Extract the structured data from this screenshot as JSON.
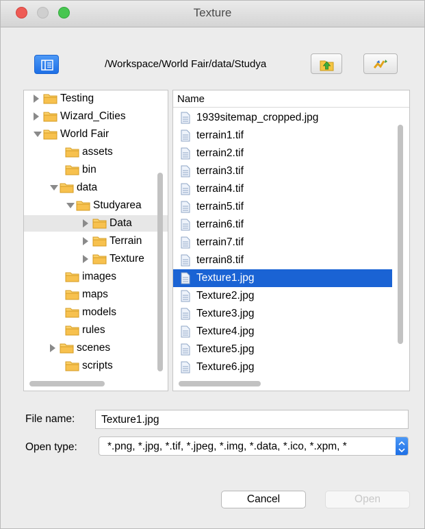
{
  "window": {
    "title": "Texture"
  },
  "toolbar": {
    "path": "/Workspace/World Fair/data/Studya",
    "nav_icon": "directory-nav-icon",
    "up_icon": "parent-folder-icon",
    "refresh_icon": "refresh-icon"
  },
  "tree": {
    "items": [
      {
        "label": "Testing",
        "expander": "collapsed"
      },
      {
        "label": "Wizard_Cities",
        "expander": "collapsed"
      },
      {
        "label": "World Fair",
        "expander": "expanded"
      },
      {
        "label": "assets",
        "expander": "none"
      },
      {
        "label": "bin",
        "expander": "none"
      },
      {
        "label": "data",
        "expander": "expanded"
      },
      {
        "label": "Studyarea",
        "expander": "expanded"
      },
      {
        "label": "Data",
        "expander": "collapsed"
      },
      {
        "label": "Terrain",
        "expander": "collapsed"
      },
      {
        "label": "Texture",
        "expander": "collapsed"
      },
      {
        "label": "images",
        "expander": "none"
      },
      {
        "label": "maps",
        "expander": "none"
      },
      {
        "label": "models",
        "expander": "none"
      },
      {
        "label": "rules",
        "expander": "none"
      },
      {
        "label": "scenes",
        "expander": "collapsed"
      },
      {
        "label": "scripts",
        "expander": "none"
      }
    ]
  },
  "files": {
    "header": "Name",
    "items": [
      "1939sitemap_cropped.jpg",
      "terrain1.tif",
      "terrain2.tif",
      "terrain3.tif",
      "terrain4.tif",
      "terrain5.tif",
      "terrain6.tif",
      "terrain7.tif",
      "terrain8.tif",
      "Texture1.jpg",
      "Texture2.jpg",
      "Texture3.jpg",
      "Texture4.jpg",
      "Texture5.jpg",
      "Texture6.jpg"
    ],
    "selected": "Texture1.jpg"
  },
  "form": {
    "file_name_label": "File name:",
    "file_name_value": "Texture1.jpg",
    "open_type_label": "Open type:",
    "open_type_value": "*.png, *.jpg, *.tif, *.jpeg, *.img, *.data, *.ico, *.xpm, *"
  },
  "buttons": {
    "cancel": "Cancel",
    "open": "Open"
  },
  "colors": {
    "selection": "#1a63d4",
    "folder": "#f5b945",
    "accent": "#2f7cf0"
  }
}
